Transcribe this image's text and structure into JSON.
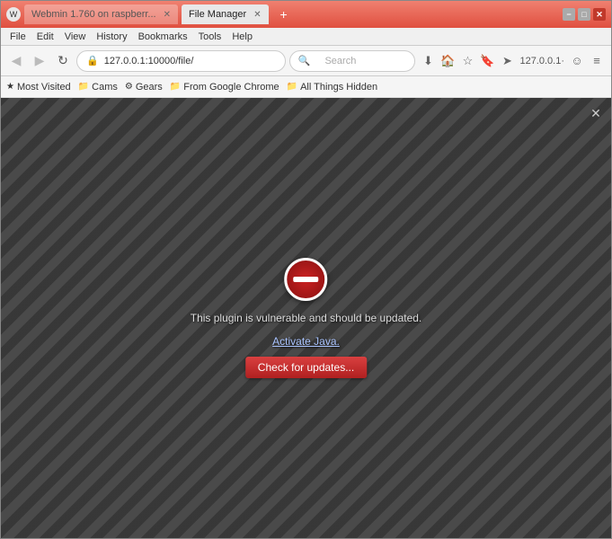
{
  "window": {
    "title": "File Manager",
    "controls": {
      "minimize": "−",
      "maximize": "□",
      "close": "✕"
    }
  },
  "tabs": [
    {
      "id": "tab1",
      "label": "Webmin 1.760 on raspberr...",
      "active": false
    },
    {
      "id": "tab2",
      "label": "File Manager",
      "active": true
    }
  ],
  "menu": {
    "items": [
      "File",
      "Edit",
      "View",
      "History",
      "Bookmarks",
      "Tools",
      "Help"
    ]
  },
  "navbar": {
    "back_btn": "◀",
    "forward_btn": "▶",
    "reload_btn": "↻",
    "home_btn": "⌂",
    "url": "127.0.0.1:10000/file/",
    "search_placeholder": "Search",
    "download_icon": "⬇",
    "home_icon": "🏠",
    "star_icon": "☆",
    "bookmark_icon": "🔖",
    "send_icon": "➤",
    "profile_label": "127.0.0.1·",
    "smiley_icon": "☺",
    "menu_icon": "≡"
  },
  "bookmarks": [
    {
      "id": "most-visited",
      "label": "Most Visited",
      "icon": "★"
    },
    {
      "id": "cams",
      "label": "Cams",
      "icon": "📁"
    },
    {
      "id": "gears",
      "label": "Gears",
      "icon": "⚙"
    },
    {
      "id": "from-google-chrome",
      "label": "From Google Chrome",
      "icon": "📁"
    },
    {
      "id": "all-things-hidden",
      "label": "All Things Hidden",
      "icon": "📁"
    }
  ],
  "plugin": {
    "message": "This plugin is vulnerable and should be updated.",
    "link_text": "Activate Java.",
    "button_label": "Check for updates..."
  },
  "colors": {
    "titlebar_start": "#f08070",
    "titlebar_end": "#e05040",
    "accent_red": "#cc2222",
    "button_red": "#d94040"
  }
}
